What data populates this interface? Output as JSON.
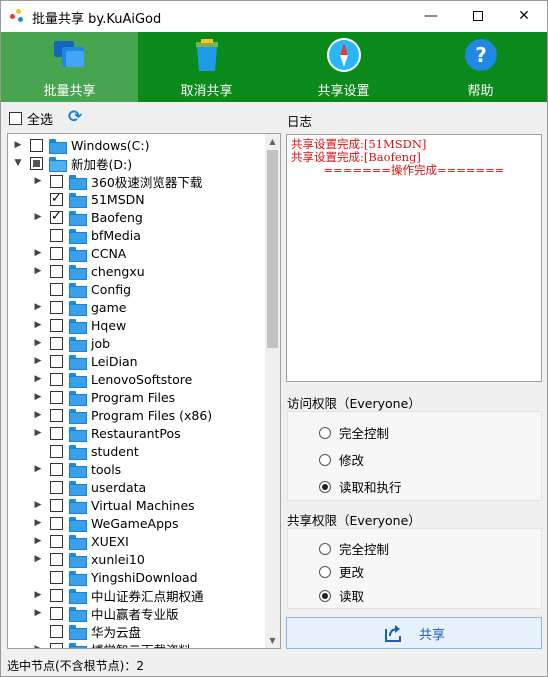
{
  "window": {
    "title": "批量共享 by.KuAiGod"
  },
  "toolbar": {
    "items": [
      {
        "label": "批量共享",
        "icon": "share-folders-icon"
      },
      {
        "label": "取消共享",
        "icon": "trash-can-icon"
      },
      {
        "label": "共享设置",
        "icon": "compass-icon"
      },
      {
        "label": "帮助",
        "icon": "help-icon"
      }
    ],
    "active_color": "#47a550",
    "bar_color": "#0a8a1a"
  },
  "select_all": {
    "label": "全选",
    "checked": false
  },
  "tree": {
    "nodes": [
      {
        "label": "Windows(C:)",
        "level": 0,
        "expand": "collapsed",
        "check": "none"
      },
      {
        "label": "新加卷(D:)",
        "level": 0,
        "expand": "expanded",
        "check": "partial"
      },
      {
        "label": "360极速浏览器下载",
        "level": 1,
        "expand": "collapsed",
        "check": "none"
      },
      {
        "label": "51MSDN",
        "level": 1,
        "expand": "none",
        "check": "checked"
      },
      {
        "label": "Baofeng",
        "level": 1,
        "expand": "collapsed",
        "check": "checked"
      },
      {
        "label": "bfMedia",
        "level": 1,
        "expand": "none",
        "check": "none"
      },
      {
        "label": "CCNA",
        "level": 1,
        "expand": "collapsed",
        "check": "none"
      },
      {
        "label": "chengxu",
        "level": 1,
        "expand": "collapsed",
        "check": "none"
      },
      {
        "label": "Config",
        "level": 1,
        "expand": "none",
        "check": "none"
      },
      {
        "label": "game",
        "level": 1,
        "expand": "collapsed",
        "check": "none"
      },
      {
        "label": "Hqew",
        "level": 1,
        "expand": "collapsed",
        "check": "none"
      },
      {
        "label": "job",
        "level": 1,
        "expand": "collapsed",
        "check": "none"
      },
      {
        "label": "LeiDian",
        "level": 1,
        "expand": "collapsed",
        "check": "none"
      },
      {
        "label": "LenovoSoftstore",
        "level": 1,
        "expand": "collapsed",
        "check": "none"
      },
      {
        "label": "Program Files",
        "level": 1,
        "expand": "collapsed",
        "check": "none"
      },
      {
        "label": "Program Files (x86)",
        "level": 1,
        "expand": "collapsed",
        "check": "none"
      },
      {
        "label": "RestaurantPos",
        "level": 1,
        "expand": "collapsed",
        "check": "none"
      },
      {
        "label": "student",
        "level": 1,
        "expand": "none",
        "check": "none"
      },
      {
        "label": "tools",
        "level": 1,
        "expand": "collapsed",
        "check": "none"
      },
      {
        "label": "userdata",
        "level": 1,
        "expand": "none",
        "check": "none"
      },
      {
        "label": "Virtual Machines",
        "level": 1,
        "expand": "collapsed",
        "check": "none"
      },
      {
        "label": "WeGameApps",
        "level": 1,
        "expand": "collapsed",
        "check": "none"
      },
      {
        "label": "XUEXI",
        "level": 1,
        "expand": "collapsed",
        "check": "none"
      },
      {
        "label": "xunlei10",
        "level": 1,
        "expand": "collapsed",
        "check": "none"
      },
      {
        "label": "YingshiDownload",
        "level": 1,
        "expand": "none",
        "check": "none"
      },
      {
        "label": "中山证券汇点期权通",
        "level": 1,
        "expand": "collapsed",
        "check": "none"
      },
      {
        "label": "中山赢者专业版",
        "level": 1,
        "expand": "collapsed",
        "check": "none"
      },
      {
        "label": "华为云盘",
        "level": 1,
        "expand": "none",
        "check": "none"
      },
      {
        "label": "博学智云下载资料",
        "level": 1,
        "expand": "collapsed",
        "check": "none"
      }
    ]
  },
  "log": {
    "label": "日志",
    "lines": [
      "共享设置完成:[51MSDN]",
      "共享设置完成:[Baofeng]"
    ],
    "done_line": "=======操作完成======="
  },
  "access": {
    "label": "访问权限（Everyone）",
    "options": [
      "完全控制",
      "修改",
      "读取和执行"
    ],
    "selected": 2
  },
  "share_perm": {
    "label": "共享权限（Everyone）",
    "options": [
      "完全控制",
      "更改",
      "读取"
    ],
    "selected": 2
  },
  "share_button": {
    "label": "共享",
    "icon": "share-arrow-icon"
  },
  "status": {
    "text": "选中节点(不含根节点)：2"
  }
}
